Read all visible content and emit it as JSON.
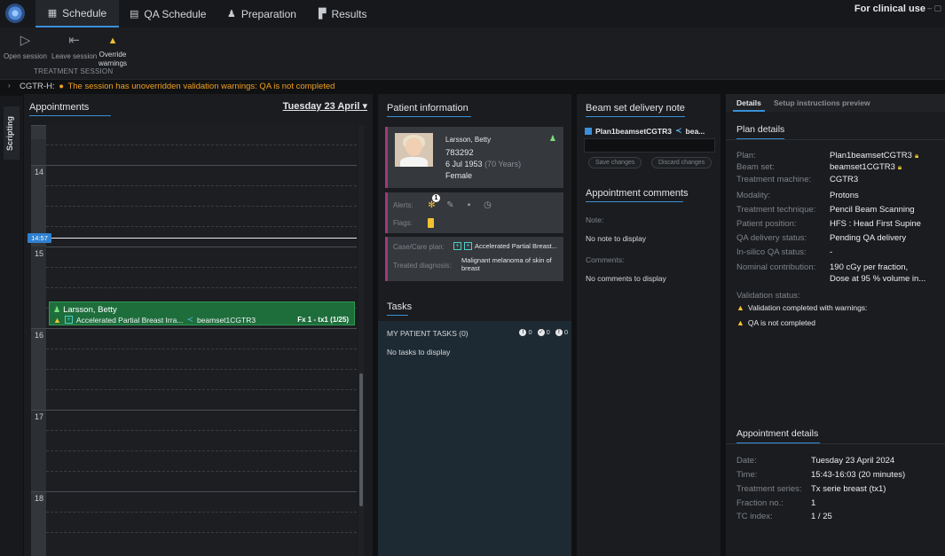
{
  "tabs": [
    {
      "label": "Schedule",
      "icon": "calendar-icon",
      "active": true
    },
    {
      "label": "QA Schedule",
      "icon": "qa-calendar-icon",
      "active": false
    },
    {
      "label": "Preparation",
      "icon": "preparation-icon",
      "active": false
    },
    {
      "label": "Results",
      "icon": "results-icon",
      "active": false
    }
  ],
  "header": {
    "clinical_use": "For clinical use"
  },
  "toolbar": {
    "open_session": "Open session",
    "leave_session": "Leave session",
    "override_line1": "Override",
    "override_line2": "warnings",
    "group_label": "TREATMENT SESSION"
  },
  "session_warning": {
    "machine": "CGTR-H:",
    "message": "The session has unoverridden validation warnings: QA is not completed"
  },
  "sidebar": {
    "scripting": "Scripting"
  },
  "appointments": {
    "title": "Appointments",
    "date": "Tuesday 23 April",
    "hours": [
      "14",
      "15",
      "16",
      "17",
      "18"
    ],
    "now_time": "14:57",
    "card": {
      "patient": "Larsson, Betty",
      "plan": "Accelerated Partial Breast Irra...",
      "beamset": "beamset1CGTR3",
      "fraction": "Fx 1 - tx1 (1/25)"
    }
  },
  "patient": {
    "title": "Patient information",
    "name": "Larsson, Betty",
    "id": "783292",
    "dob": "6 Jul 1953",
    "age": "(70 Years)",
    "sex": "Female",
    "alerts_label": "Alerts:",
    "alerts_badge": "1",
    "flags_label": "Flags:",
    "case_label": "Case/Care plan:",
    "case_value": "Accelerated Partial Breast...",
    "diagnosis_label": "Treated diagnosis:",
    "diagnosis_line1": "Malignant melanoma of skin of",
    "diagnosis_line2": "breast"
  },
  "tasks": {
    "title": "Tasks",
    "header": "MY PATIENT TASKS (0)",
    "counts": [
      "0",
      "0",
      "0"
    ],
    "empty": "No tasks to display"
  },
  "beam_note": {
    "title": "Beam set delivery note",
    "plan": "Plan1beamsetCGTR3",
    "beamset_short": "bea...",
    "save": "Save changes",
    "discard": "Discard changes"
  },
  "comments": {
    "title": "Appointment comments",
    "note_label": "Note:",
    "note_value": "No note to display",
    "comments_label": "Comments:",
    "comments_value": "No comments to display"
  },
  "details": {
    "tab_details": "Details",
    "tab_setup": "Setup instructions preview",
    "plan_title": "Plan details",
    "rows": [
      {
        "label": "Plan:",
        "value": "Plan1beamsetCGTR3"
      },
      {
        "label": "Beam set:",
        "value": "beamset1CGTR3"
      },
      {
        "label": "Treatment machine:",
        "value": "CGTR3"
      },
      {
        "label": "Modality:",
        "value": "Protons"
      },
      {
        "label": "Treatment technique:",
        "value": "Pencil Beam Scanning"
      },
      {
        "label": "Patient position:",
        "value": "HFS : Head First Supine"
      },
      {
        "label": "QA delivery status:",
        "value": "Pending QA delivery"
      },
      {
        "label": "In-silico QA status:",
        "value": "-"
      },
      {
        "label": "Nominal contribution:",
        "value": "190 cGy per fraction,"
      }
    ],
    "nominal_line2": "Dose at 95 % volume in...",
    "validation_label": "Validation status:",
    "validation_1": "Validation completed with warnings:",
    "validation_2": "QA is not completed",
    "appt_title": "Appointment details",
    "appt_rows": [
      {
        "label": "Date:",
        "value": "Tuesday 23 April 2024"
      },
      {
        "label": "Time:",
        "value": "15:43-16:03 (20 minutes)"
      },
      {
        "label": "Treatment series:",
        "value": "Tx serie breast (tx1)"
      },
      {
        "label": "Fraction no.:",
        "value": "1"
      },
      {
        "label": "TC index:",
        "value": "1 / 25"
      }
    ]
  },
  "colors": {
    "accent": "#3a8fd8",
    "warning": "#f0a020",
    "appointment": "#1e6e3c"
  }
}
